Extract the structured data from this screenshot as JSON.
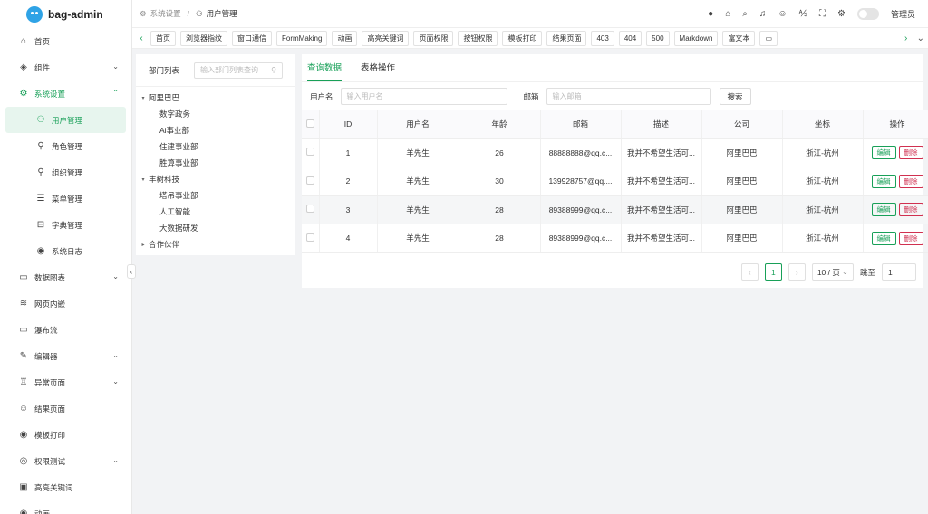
{
  "app": {
    "title": "bag-admin",
    "accent": "#18a058"
  },
  "sidebar": {
    "items": [
      {
        "label": "首页",
        "icon": "home-icon",
        "glyph": "⌂",
        "caret": ""
      },
      {
        "label": "组件",
        "icon": "cube-icon",
        "glyph": "◈",
        "caret": "⌄"
      },
      {
        "label": "系统设置",
        "icon": "gear-icon",
        "glyph": "⚙",
        "caret": "⌃",
        "active": true
      },
      {
        "label": "用户管理",
        "icon": "users-icon",
        "glyph": "⚇",
        "sub": true,
        "selected": true
      },
      {
        "label": "角色管理",
        "icon": "user-icon",
        "glyph": "⚲",
        "sub": true
      },
      {
        "label": "组织管理",
        "icon": "org-icon",
        "glyph": "⚲",
        "sub": true
      },
      {
        "label": "菜单管理",
        "icon": "menu-icon",
        "glyph": "☰",
        "sub": true
      },
      {
        "label": "字典管理",
        "icon": "book-icon",
        "glyph": "⊟",
        "sub": true
      },
      {
        "label": "系统日志",
        "icon": "eye-icon",
        "glyph": "◉",
        "sub": true
      },
      {
        "label": "数据图表",
        "icon": "chart-icon",
        "glyph": "▭",
        "caret": "⌄"
      },
      {
        "label": "网页内嵌",
        "icon": "layers-icon",
        "glyph": "≋",
        "caret": ""
      },
      {
        "label": "瀑布流",
        "icon": "monitor-icon",
        "glyph": "▭",
        "caret": ""
      },
      {
        "label": "编辑器",
        "icon": "edit-icon",
        "glyph": "✎",
        "caret": "⌄"
      },
      {
        "label": "异常页面",
        "icon": "trophy-icon",
        "glyph": "♖",
        "caret": "⌄"
      },
      {
        "label": "结果页面",
        "icon": "smile-icon",
        "glyph": "☺",
        "caret": ""
      },
      {
        "label": "模板打印",
        "icon": "record-icon",
        "glyph": "◉",
        "caret": ""
      },
      {
        "label": "权限测试",
        "icon": "shield-icon",
        "glyph": "◎",
        "caret": "⌄"
      },
      {
        "label": "高亮关键词",
        "icon": "highlight-icon",
        "glyph": "▣",
        "caret": ""
      },
      {
        "label": "动画",
        "icon": "animation-icon",
        "glyph": "◉",
        "caret": ""
      }
    ]
  },
  "header": {
    "breadcrumb": [
      "系统设置",
      "用户管理"
    ],
    "user": "管理员"
  },
  "tabs": [
    "首页",
    "浏览器指纹",
    "窗口通信",
    "FormMaking",
    "动画",
    "高亮关键词",
    "页面权限",
    "按钮权限",
    "模板打印",
    "结果页面",
    "403",
    "404",
    "500",
    "Markdown",
    "富文本",
    "▭"
  ],
  "dept": {
    "title": "部门列表",
    "search_placeholder": "输入部门列表查询",
    "tree": [
      {
        "label": "阿里巴巴",
        "level": 0,
        "arrow": "▾"
      },
      {
        "label": "数字政务",
        "level": 1
      },
      {
        "label": "Ai事业部",
        "level": 1
      },
      {
        "label": "住建事业部",
        "level": 1
      },
      {
        "label": "胜算事业部",
        "level": 1
      },
      {
        "label": "丰树科技",
        "level": 0,
        "arrow": "▾"
      },
      {
        "label": "塔吊事业部",
        "level": 1
      },
      {
        "label": "人工智能",
        "level": 1
      },
      {
        "label": "大数据研发",
        "level": 1
      },
      {
        "label": "合作伙伴",
        "level": 0,
        "arrow": "▸"
      }
    ]
  },
  "main": {
    "tabs": [
      "查询数据",
      "表格操作"
    ],
    "filter": {
      "username_label": "用户名",
      "username_placeholder": "输入用户名",
      "email_label": "邮箱",
      "email_placeholder": "输入邮箱",
      "search_label": "搜索"
    },
    "table": {
      "headers": [
        "ID",
        "用户名",
        "年龄",
        "邮箱",
        "描述",
        "公司",
        "坐标",
        "操作"
      ],
      "rows": [
        {
          "id": "1",
          "name": "羊先生",
          "age": "26",
          "email": "88888888@qq.c...",
          "desc": "我并不希望生活可...",
          "company": "阿里巴巴",
          "coord": "浙江-杭州"
        },
        {
          "id": "2",
          "name": "羊先生",
          "age": "30",
          "email": "139928757@qq....",
          "desc": "我并不希望生活可...",
          "company": "阿里巴巴",
          "coord": "浙江-杭州"
        },
        {
          "id": "3",
          "name": "羊先生",
          "age": "28",
          "email": "89388999@qq.c...",
          "desc": "我并不希望生活可...",
          "company": "阿里巴巴",
          "coord": "浙江-杭州"
        },
        {
          "id": "4",
          "name": "羊先生",
          "age": "28",
          "email": "89388999@qq.c...",
          "desc": "我并不希望生活可...",
          "company": "阿里巴巴",
          "coord": "浙江-杭州"
        }
      ],
      "edit_label": "编辑",
      "delete_label": "删除"
    },
    "pagination": {
      "current": "1",
      "page_size": "10 / 页",
      "jump_label": "跳至",
      "jump_value": "1"
    }
  }
}
